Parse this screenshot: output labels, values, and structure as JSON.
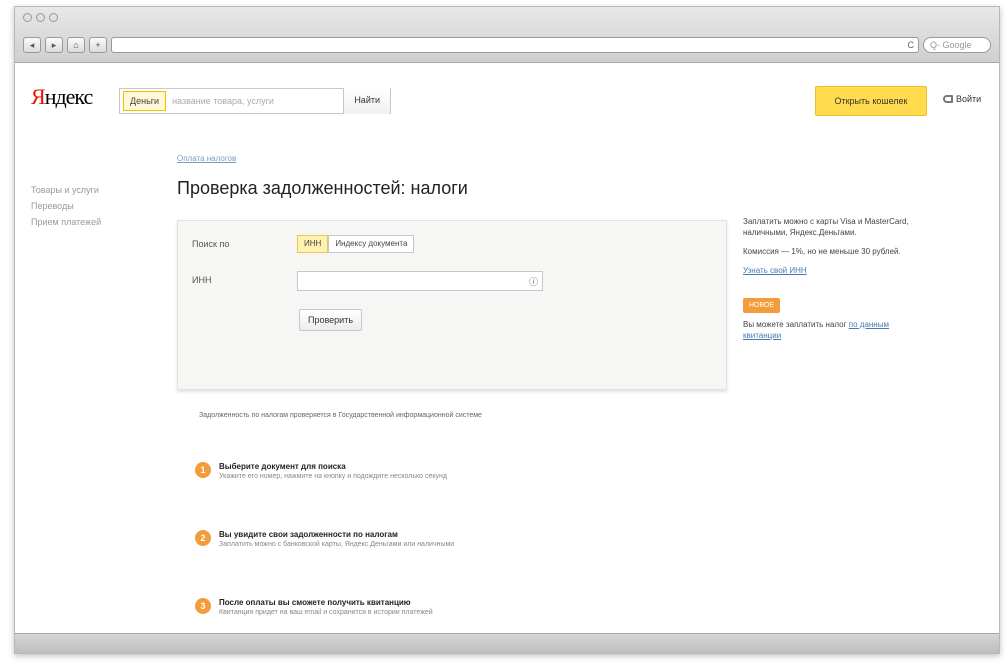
{
  "browser": {
    "nav_back": "◂",
    "nav_fwd": "▸",
    "nav_home": "⌂",
    "nav_plus": "+",
    "address": "",
    "reload_icon": "C",
    "search_placeholder": "Q- Google"
  },
  "header": {
    "logo_first": "Я",
    "logo_rest": "ндекс",
    "search_service": "Деньги",
    "search_placeholder": "название товара, услуги",
    "search_button": "Найти",
    "open_wallet": "Открыть кошелек",
    "login": "Войти"
  },
  "sidebar": {
    "items": [
      "Товары и услуги",
      "Переводы",
      "Прием платежей"
    ]
  },
  "main": {
    "breadcrumb": "Оплата налогов",
    "title": "Проверка задолженностей: налоги",
    "form": {
      "search_by_label": "Поиск по",
      "option_inn": "ИНН",
      "option_doc": "Индексу документа",
      "inn_label": "ИНН",
      "inn_value": "",
      "check_button": "Проверить"
    },
    "info_note": "Задолженность по налогам проверяется в Государственной информационной системе",
    "steps": [
      {
        "num": "1",
        "title": "Выберите документ для поиска",
        "desc": "Укажите его номер, нажмите на кнопку и подождите несколько секунд"
      },
      {
        "num": "2",
        "title": "Вы увидите свои задолженности по налогам",
        "desc": "Заплатить можно с банковской карты, Яндекс.Деньгами или наличными"
      },
      {
        "num": "3",
        "title": "После оплаты вы сможете получить квитанцию",
        "desc": "Квитанция придет на ваш email и сохранится в истории платежей"
      }
    ]
  },
  "aside": {
    "p1": "Заплатить можно с карты Visa и MasterCard, наличными, Яндекс.Деньгами.",
    "p2": "Комиссия — 1%, но не меньше 30 рублей.",
    "link1": "Узнать свой ИНН",
    "badge": "НОВОЕ",
    "p3": "Вы можете заплатить налог",
    "link2": "по данным квитанции"
  }
}
